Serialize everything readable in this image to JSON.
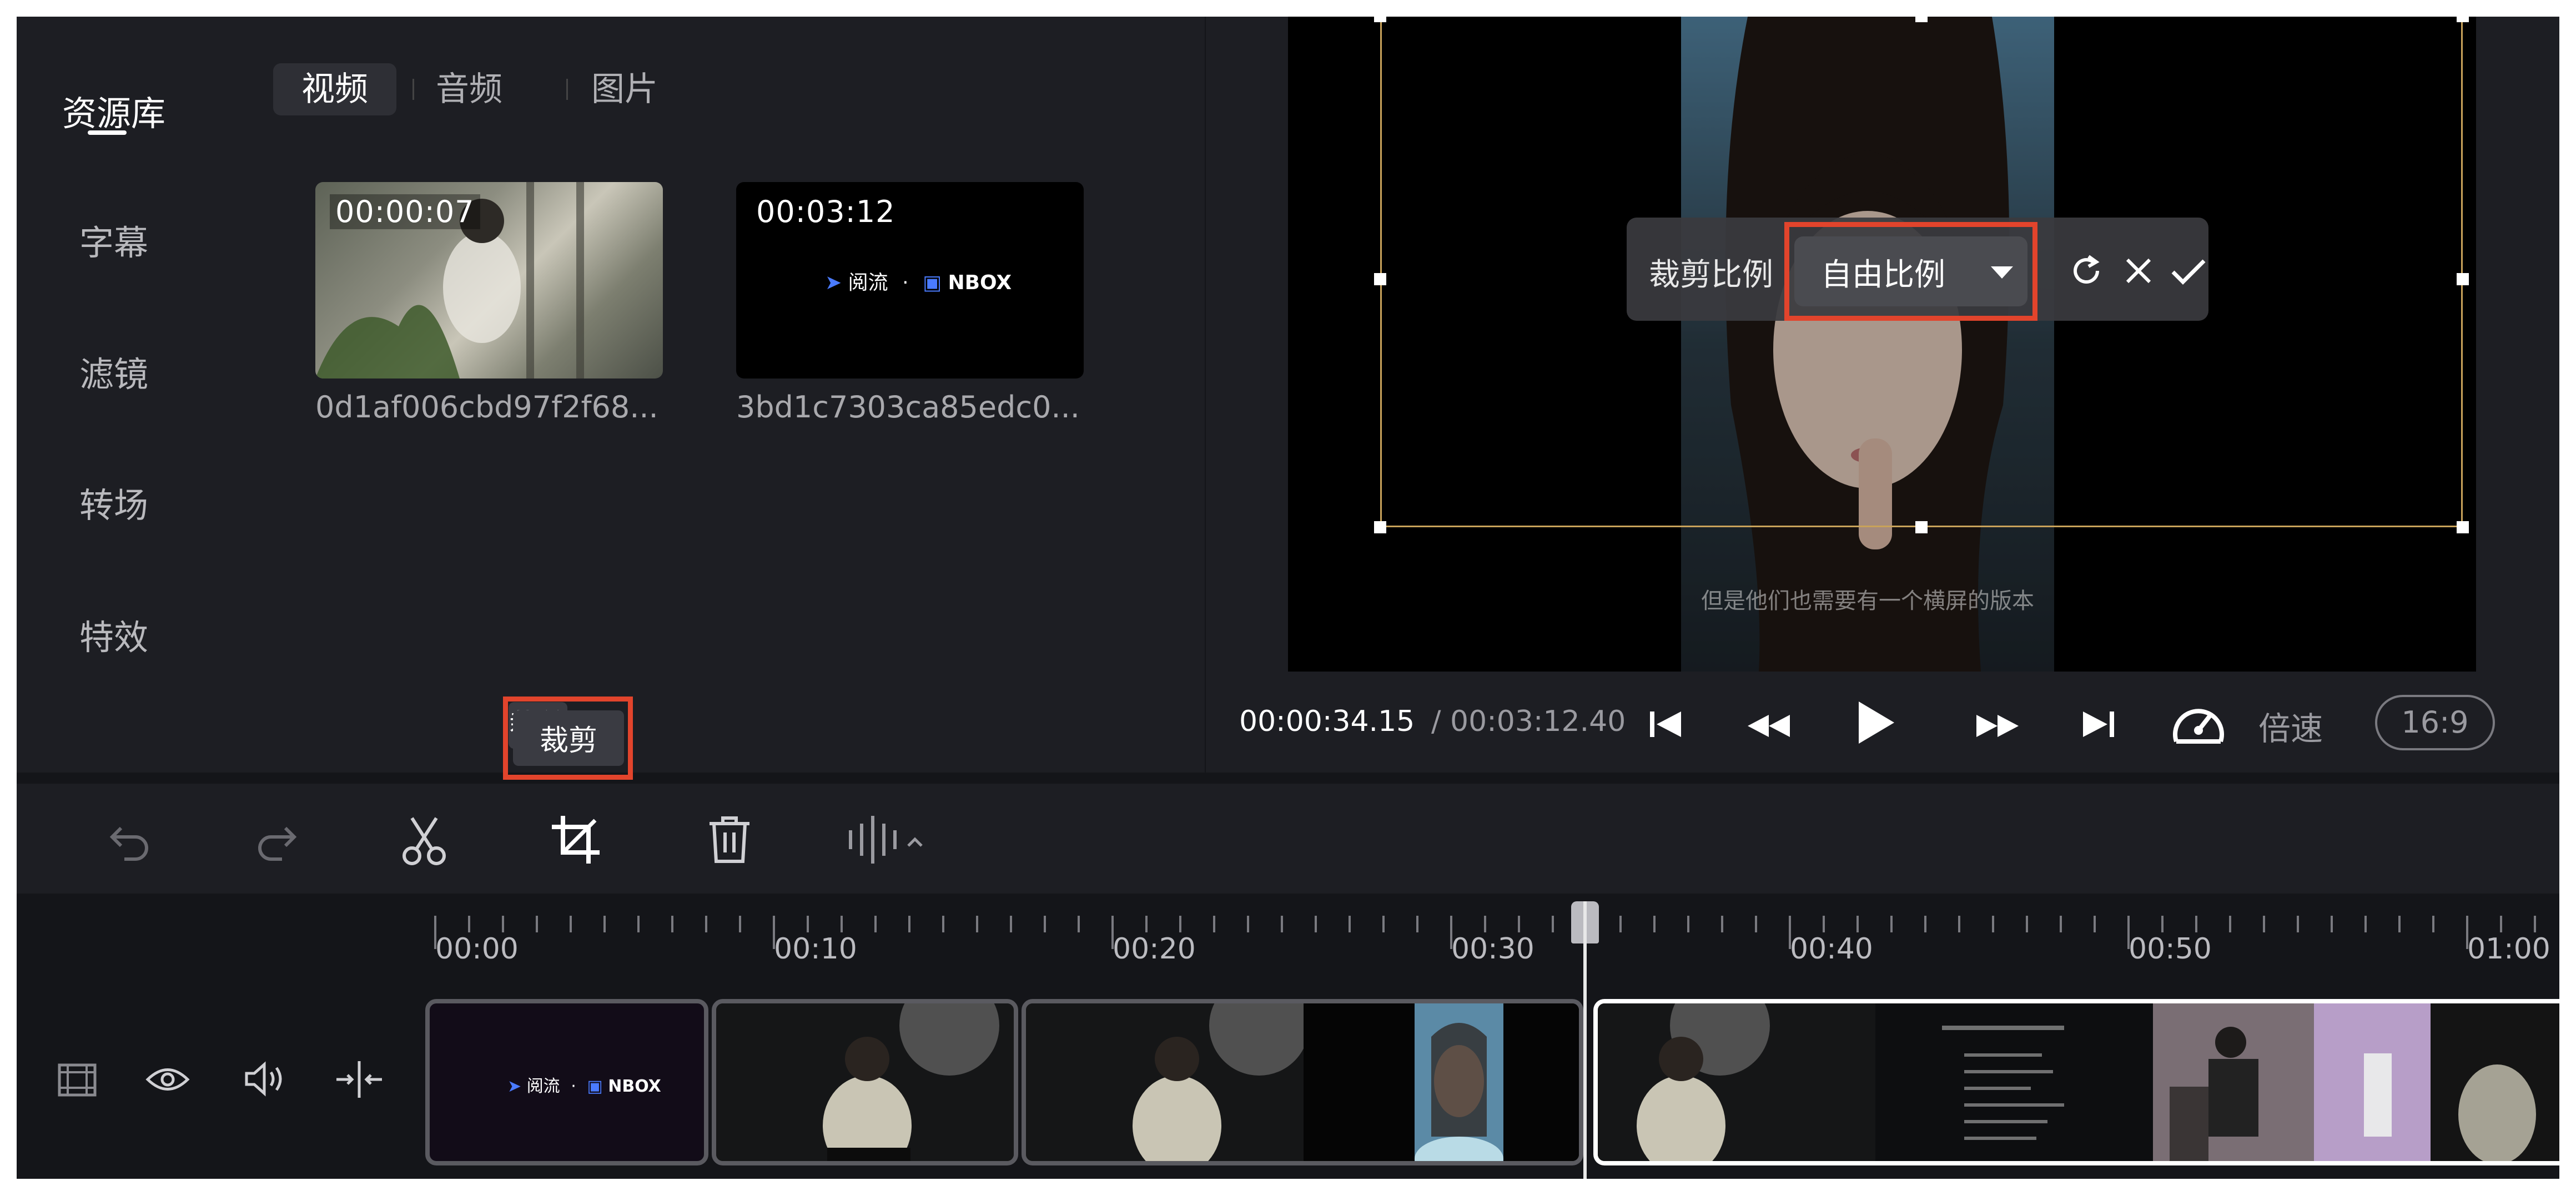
{
  "sidebar": {
    "items": [
      {
        "label": "资源库",
        "active": true
      },
      {
        "label": "字幕"
      },
      {
        "label": "滤镜"
      },
      {
        "label": "转场"
      },
      {
        "label": "特效"
      }
    ]
  },
  "media": {
    "tabs": [
      {
        "label": "视频",
        "active": true
      },
      {
        "label": "音频"
      },
      {
        "label": "图片"
      }
    ],
    "items": [
      {
        "duration": "00:00:07",
        "name": "0d1af006cbd97f2f68..."
      },
      {
        "duration": "00:03:12",
        "name": "3bd1c7303ca85edc0...",
        "logo_left": "阅流",
        "logo_dot": "·",
        "logo_right": "NBOX"
      }
    ],
    "crop_button_label": "裁剪"
  },
  "preview": {
    "subtitle": "但是他们也需要有一个横屏的版本",
    "crop_toolbar": {
      "label": "裁剪比例",
      "ratio_value": "自由比例",
      "icons": [
        "reset-icon",
        "close-icon",
        "check-icon"
      ]
    },
    "time_current": "00:00:34.15",
    "time_total": "/ 00:03:12.40",
    "speed_label": "倍速",
    "aspect_label": "16:9"
  },
  "toolbar": {
    "icons": [
      "undo-icon",
      "redo-icon",
      "scissors-icon",
      "crop-icon",
      "trash-icon",
      "audio-wave-icon"
    ]
  },
  "timeline": {
    "ticks": [
      "00:00",
      "00:10",
      "00:20",
      "00:30",
      "00:40",
      "00:50",
      "01:00"
    ],
    "track_icons": [
      "film-icon",
      "eye-icon",
      "volume-icon",
      "split-icon"
    ],
    "intro_logo_left": "阅流",
    "intro_logo_right": "NBOX"
  },
  "colors": {
    "background": "#141519",
    "panel": "#1d1e23",
    "highlight": "#e2442c",
    "crop_frame": "#c8a25a"
  }
}
